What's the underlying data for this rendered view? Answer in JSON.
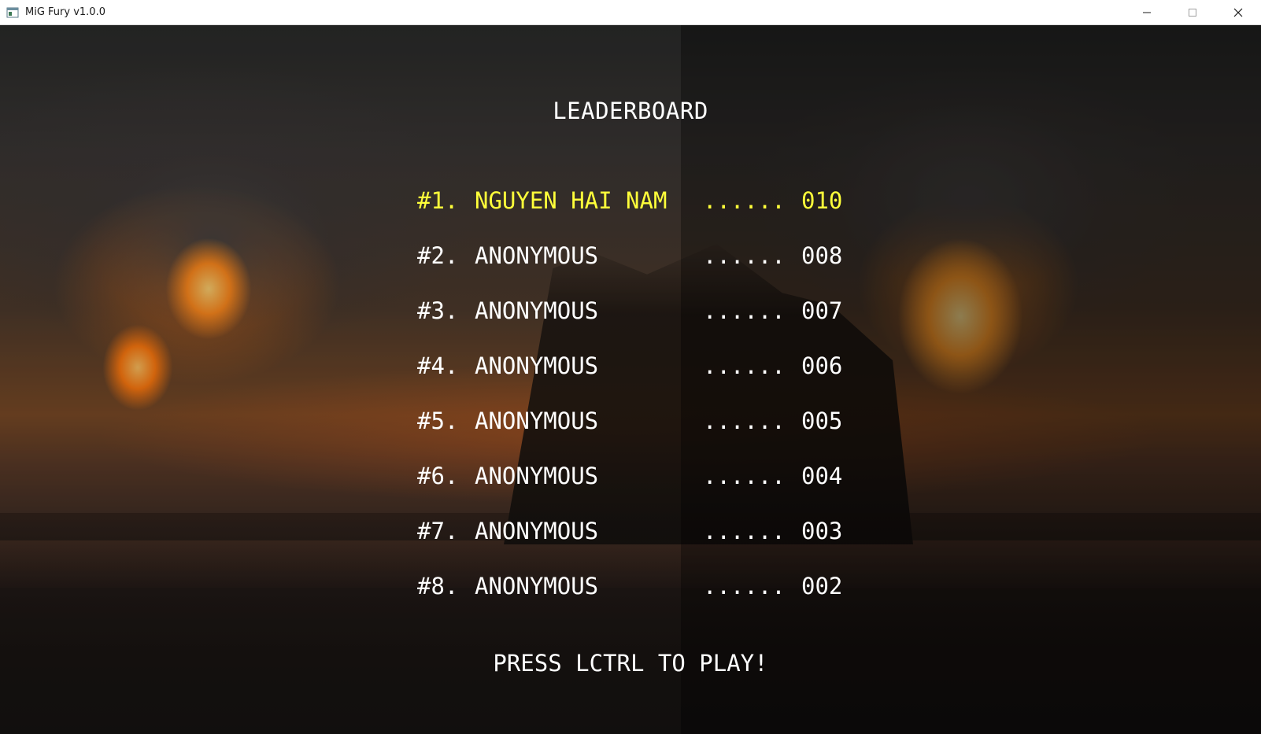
{
  "window": {
    "title": "MiG Fury v1.0.0",
    "app_icon": "app-window-icon",
    "controls": [
      "minimize-icon",
      "maximize-icon",
      "close-icon"
    ]
  },
  "game": {
    "title": "LEADERBOARD",
    "highlight_color": "#ffff3a",
    "text_color": "#ffffff",
    "entries": [
      {
        "rank": "#1.",
        "name": "NGUYEN HAI NAM",
        "dots": "......",
        "score": "010"
      },
      {
        "rank": "#2.",
        "name": "ANONYMOUS",
        "dots": "......",
        "score": "008"
      },
      {
        "rank": "#3.",
        "name": "ANONYMOUS",
        "dots": "......",
        "score": "007"
      },
      {
        "rank": "#4.",
        "name": "ANONYMOUS",
        "dots": "......",
        "score": "006"
      },
      {
        "rank": "#5.",
        "name": "ANONYMOUS",
        "dots": "......",
        "score": "005"
      },
      {
        "rank": "#6.",
        "name": "ANONYMOUS",
        "dots": "......",
        "score": "004"
      },
      {
        "rank": "#7.",
        "name": "ANONYMOUS",
        "dots": "......",
        "score": "003"
      },
      {
        "rank": "#8.",
        "name": "ANONYMOUS",
        "dots": "......",
        "score": "002"
      }
    ],
    "prompt": "PRESS LCTRL TO PLAY!"
  }
}
